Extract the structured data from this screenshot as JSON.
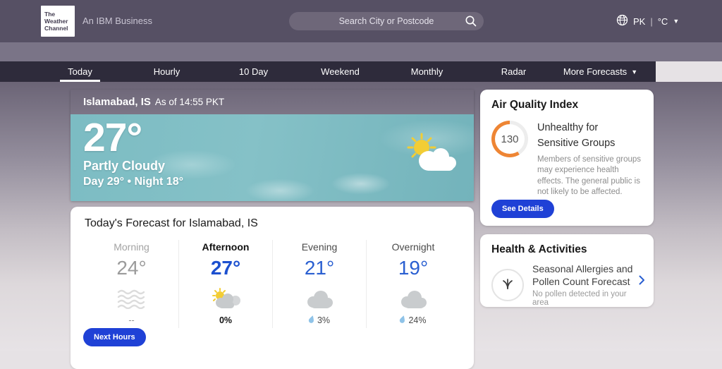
{
  "header": {
    "logo_lines": [
      "The",
      "Weather",
      "Channel"
    ],
    "tagline": "An IBM Business",
    "search_placeholder": "Search City or Postcode",
    "country_code": "PK",
    "divider": "|",
    "unit_label": "°C",
    "caret": "▼"
  },
  "nav": {
    "tabs": [
      {
        "label": "Today",
        "active": true
      },
      {
        "label": "Hourly"
      },
      {
        "label": "10 Day"
      },
      {
        "label": "Weekend"
      },
      {
        "label": "Monthly"
      },
      {
        "label": "Radar"
      },
      {
        "label": "More Forecasts"
      }
    ]
  },
  "current": {
    "location": "Islamabad, IS",
    "as_of": "As of 14:55 PKT",
    "temperature": "27°",
    "condition": "Partly Cloudy",
    "day_night": "Day 29° • Night 18°",
    "icon": "sun-behind-cloud-icon"
  },
  "today_forecast": {
    "title": "Today's Forecast for Islamabad, IS",
    "periods": [
      {
        "label": "Morning",
        "temp": "24°",
        "icon": "haze-icon",
        "precip": "--"
      },
      {
        "label": "Afternoon",
        "temp": "27°",
        "icon": "partly-cloudy-icon",
        "precip": "0%"
      },
      {
        "label": "Evening",
        "temp": "21°",
        "icon": "cloudy-icon",
        "precip": "3%"
      },
      {
        "label": "Overnight",
        "temp": "19°",
        "icon": "cloudy-icon",
        "precip": "24%"
      }
    ],
    "next_hours_label": "Next Hours"
  },
  "air_quality": {
    "title": "Air Quality Index",
    "value": "130",
    "level": "Unhealthy for Sensitive Groups",
    "description": "Members of sensitive groups may experience health effects. The general public is not likely to be affected.",
    "see_details_label": "See Details"
  },
  "health": {
    "title": "Health & Activities",
    "item_title": "Seasonal Allergies and Pollen Count Forecast",
    "item_subtitle": "No pollen detected in your area",
    "item_icon": "grass-pollen-icon"
  },
  "colors": {
    "accent_blue": "#1f41d6",
    "aqi_orange": "#ee8534",
    "temp_blue": "#2a5fd1",
    "header_purple": "#565064",
    "nav_dark": "#2e2b3b",
    "sky_teal": "#7cbcc3"
  }
}
